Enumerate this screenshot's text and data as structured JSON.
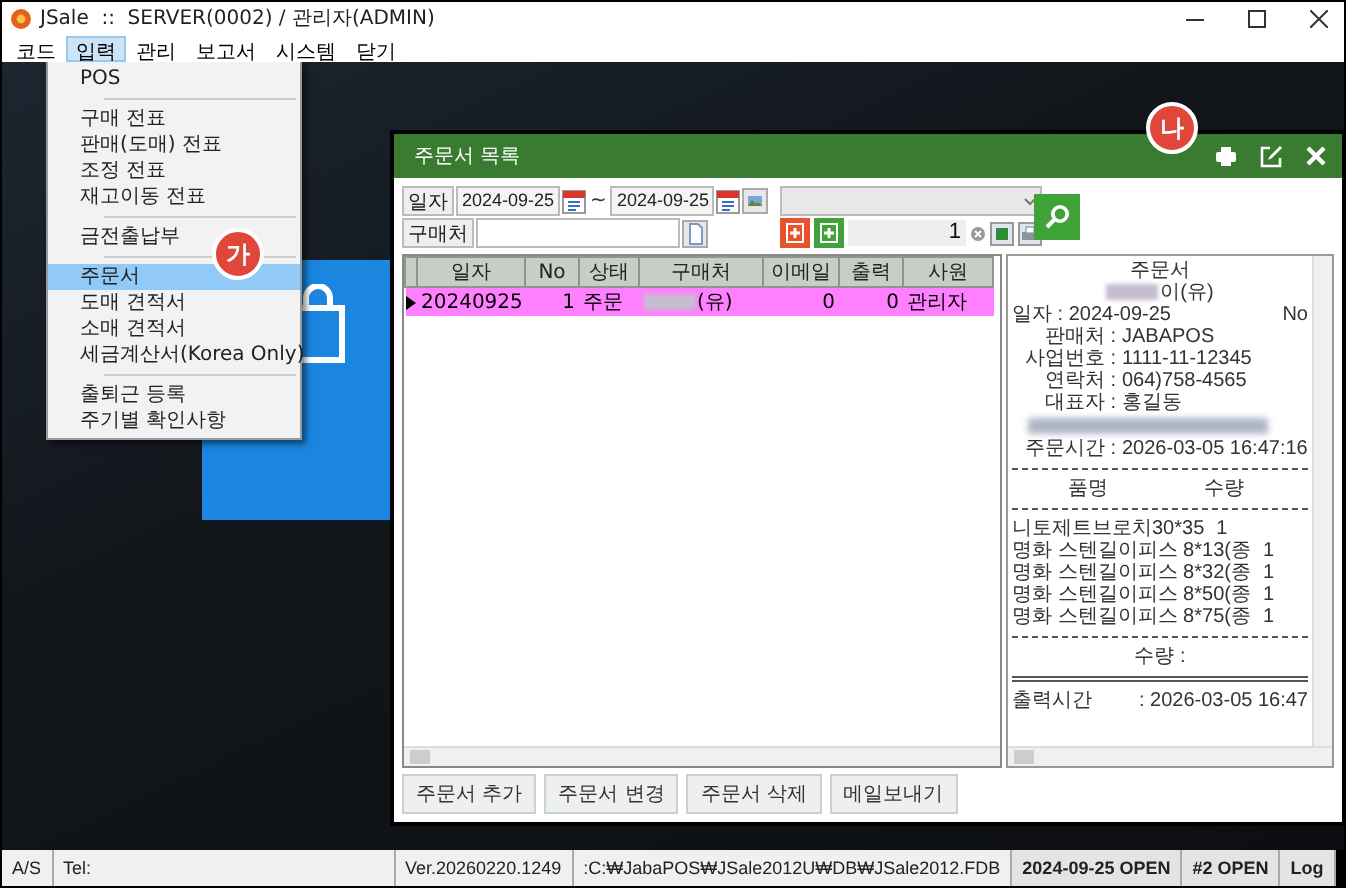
{
  "app": {
    "title": "JSale  ::  SERVER(0002) / 관리자(ADMIN)"
  },
  "menu_bar": [
    {
      "label": "코드",
      "selected": false
    },
    {
      "label": "입력",
      "selected": true
    },
    {
      "label": "관리",
      "selected": false
    },
    {
      "label": "보고서",
      "selected": false
    },
    {
      "label": "시스템",
      "selected": false
    },
    {
      "label": "닫기",
      "selected": false
    }
  ],
  "dropdown": {
    "groups": [
      [
        {
          "label": "POS",
          "selected": false
        }
      ],
      [
        {
          "label": "구매 전표",
          "selected": false
        },
        {
          "label": "판매(도매) 전표",
          "selected": false
        },
        {
          "label": "조정 전표",
          "selected": false
        },
        {
          "label": "재고이동 전표",
          "selected": false
        }
      ],
      [
        {
          "label": "금전출납부",
          "selected": false
        }
      ],
      [
        {
          "label": "주문서",
          "selected": true
        },
        {
          "label": "도매 견적서",
          "selected": false
        },
        {
          "label": "소매 견적서",
          "selected": false
        },
        {
          "label": "세금계산서(Korea Only)",
          "selected": false
        }
      ],
      [
        {
          "label": "출퇴근 등록",
          "selected": false
        },
        {
          "label": "주기별 확인사항",
          "selected": false
        }
      ]
    ]
  },
  "annotations": [
    {
      "label": "가"
    },
    {
      "label": "나"
    }
  ],
  "order_window": {
    "title": "주문서 목록",
    "filters": {
      "date_button": "일자",
      "date_from": "2024-09-25",
      "range_sep": "~",
      "date_to": "2024-09-25",
      "buyer_button": "구매처",
      "page": "1"
    },
    "table": {
      "columns": [
        "일자",
        "No",
        "상태",
        "구매처",
        "이메일",
        "출력",
        "사원"
      ],
      "rows": [
        {
          "selected": true,
          "cells": [
            {
              "text": "20240925",
              "blurred": false
            },
            {
              "text": "1",
              "blurred": false
            },
            {
              "text": "주문",
              "blurred": false
            },
            {
              "text": "(유)",
              "blurred": true
            },
            {
              "text": "0",
              "blurred": false
            },
            {
              "text": "0",
              "blurred": false
            },
            {
              "text": "관리자",
              "blurred": false
            }
          ]
        }
      ]
    },
    "receipt": {
      "lines": [
        {
          "kind": "center",
          "text": "주문서",
          "blurred": false
        },
        {
          "kind": "center",
          "text": "이(유)",
          "blurred": true
        },
        {
          "kind": "split",
          "left": "일자 : 2024-09-25",
          "right": "No"
        },
        {
          "kind": "field",
          "label": "판매처 :",
          "value": "JABAPOS"
        },
        {
          "kind": "field",
          "label": "사업번호 :",
          "value": "1111-11-12345"
        },
        {
          "kind": "field",
          "label": "연락처 :",
          "value": "064)758-4565"
        },
        {
          "kind": "field",
          "label": "대표자 :",
          "value": "홍길동"
        },
        {
          "kind": "blur"
        },
        {
          "kind": "field",
          "label": "주문시간 :",
          "value": "2026-03-05 16:47:16"
        },
        {
          "kind": "rule"
        },
        {
          "kind": "header",
          "name": "품명",
          "qty": "수량"
        },
        {
          "kind": "rule"
        },
        {
          "kind": "item",
          "name": "니토제트브로치30*35",
          "qty": "1"
        },
        {
          "kind": "item",
          "name": "명화 스텐길이피스 8*13(종",
          "qty": "1"
        },
        {
          "kind": "item",
          "name": "명화 스텐길이피스 8*32(종",
          "qty": "1"
        },
        {
          "kind": "item",
          "name": "명화 스텐길이피스 8*50(종",
          "qty": "1"
        },
        {
          "kind": "item",
          "name": "명화 스텐길이피스 8*75(종",
          "qty": "1"
        },
        {
          "kind": "rule"
        },
        {
          "kind": "center",
          "text": "수량 :",
          "blurred": false
        },
        {
          "kind": "double_rule"
        },
        {
          "kind": "split",
          "left": "출력시간",
          "right": ": 2026-03-05 16:47"
        }
      ]
    },
    "buttons": [
      "주문서 추가",
      "주문서 변경",
      "주문서 삭제",
      "메일보내기"
    ]
  },
  "status_bar": [
    {
      "text": "A/S",
      "bold": false
    },
    {
      "text": "Tel:",
      "bold": false
    },
    {
      "text": "Ver.20260220.1249",
      "bold": false
    },
    {
      "text": ":C:₩JabaPOS₩JSale2012U₩DB₩JSale2012.FDB",
      "bold": false
    },
    {
      "text": "2024-09-25 OPEN",
      "bold": true
    },
    {
      "text": "#2 OPEN",
      "bold": true
    },
    {
      "text": "Log",
      "bold": true
    }
  ]
}
